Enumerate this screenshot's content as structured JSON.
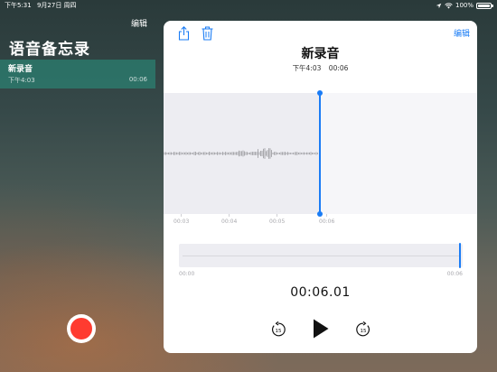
{
  "status_bar": {
    "time": "下午5:31",
    "date": "9月27日 周四",
    "battery_percent": "100%",
    "battery_level": 1.0
  },
  "sidebar": {
    "edit_label": "编辑",
    "title": "语音备忘录",
    "recordings": [
      {
        "name": "新录音",
        "date": "下午4:03",
        "duration": "00:06"
      }
    ]
  },
  "detail": {
    "edit_label": "编辑",
    "title": "新录音",
    "time": "下午4:03",
    "duration": "00:06",
    "timeline_ticks": [
      "00:03",
      "00:04",
      "00:05",
      "00:06"
    ],
    "overview_start": "00:00",
    "overview_end": "00:06",
    "elapsed": "00:06.01",
    "skip_back_label": "15",
    "skip_forward_label": "15"
  },
  "icons": {
    "share": "share-icon",
    "trash": "trash-icon",
    "play": "play-icon",
    "skip_back": "skip-back-15-icon",
    "skip_forward": "skip-forward-15-icon",
    "record": "record-icon",
    "wifi": "wifi-icon",
    "battery": "battery-icon"
  },
  "colors": {
    "accent": "#1a7cf5",
    "record": "#ff3b30",
    "selected_row": "#2a9682"
  }
}
